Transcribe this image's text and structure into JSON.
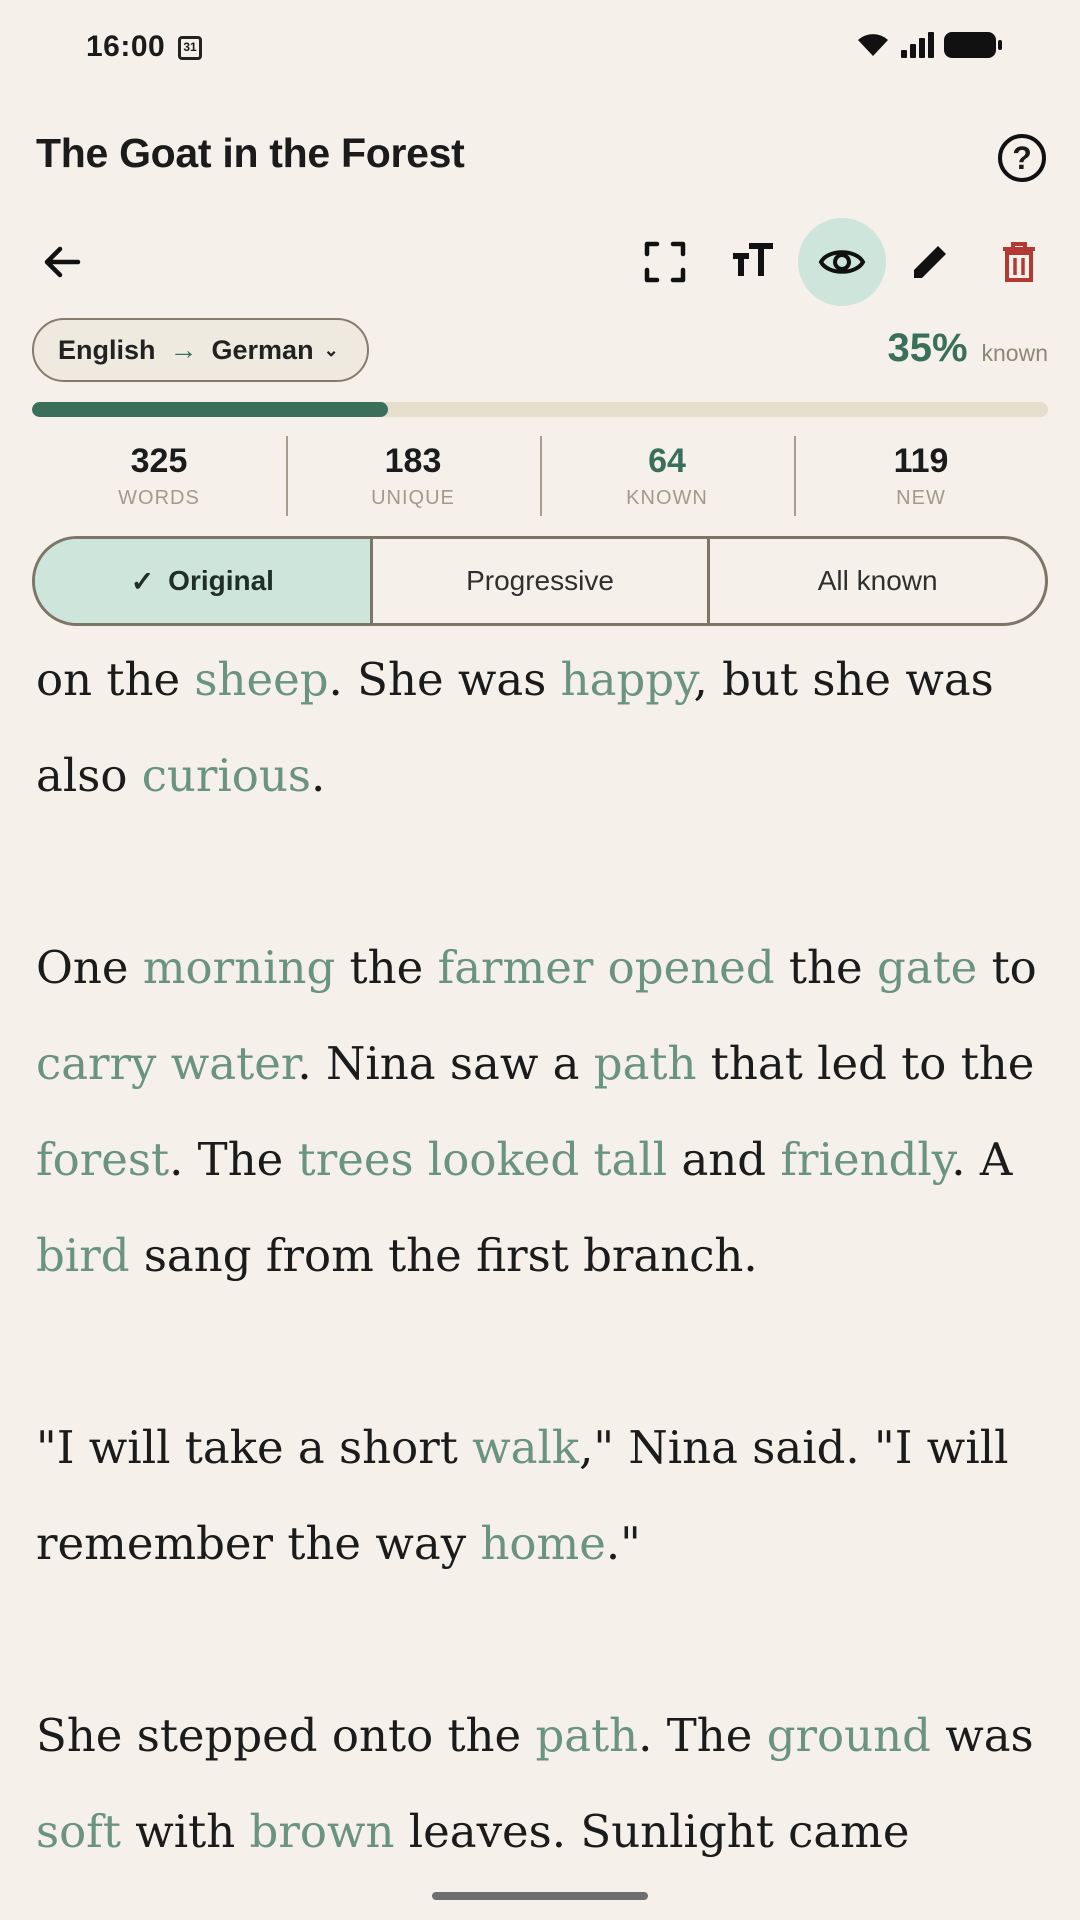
{
  "status": {
    "time": "16:00",
    "calendar_day": "31"
  },
  "header": {
    "title": "The Goat in the Forest",
    "help_icon": "help-icon"
  },
  "toolbar": {
    "icons": [
      "back-arrow-icon",
      "fullscreen-icon",
      "text-size-icon",
      "eye-icon",
      "edit-pencil-icon",
      "delete-trash-icon"
    ],
    "active": "eye-icon",
    "accent": "#CDE5DA",
    "danger": "#B33A34"
  },
  "language": {
    "source": "English",
    "target": "German",
    "arrow": "→"
  },
  "progress": {
    "percent_label": "35%",
    "known_label": "known",
    "fraction": 0.35
  },
  "stats": {
    "words": {
      "value": "325",
      "label": "WORDS"
    },
    "unique": {
      "value": "183",
      "label": "UNIQUE"
    },
    "known": {
      "value": "64",
      "label": "KNOWN"
    },
    "new": {
      "value": "119",
      "label": "NEW"
    }
  },
  "modes": {
    "original": "Original",
    "progressive": "Progressive",
    "all_known": "All known",
    "selected": "Original"
  },
  "colors": {
    "background": "#F5F0E9",
    "known_word": "#6A9380",
    "primary": "#3A6F5B"
  },
  "paragraphs": [
    [
      {
        "t": "on the "
      },
      {
        "t": "sheep",
        "h": true
      },
      {
        "t": ". She was "
      },
      {
        "t": "happy",
        "h": true
      },
      {
        "t": ", but she was also "
      },
      {
        "t": "curious",
        "h": true
      },
      {
        "t": "."
      }
    ],
    [
      {
        "t": "One "
      },
      {
        "t": "morning",
        "h": true
      },
      {
        "t": " the "
      },
      {
        "t": "farmer opened",
        "h": true
      },
      {
        "t": " the "
      },
      {
        "t": "gate",
        "h": true
      },
      {
        "t": " to "
      },
      {
        "t": "carry water",
        "h": true
      },
      {
        "t": ". Nina saw a "
      },
      {
        "t": "path",
        "h": true
      },
      {
        "t": " that led to the "
      },
      {
        "t": "forest",
        "h": true
      },
      {
        "t": ". The "
      },
      {
        "t": "trees looked tall",
        "h": true
      },
      {
        "t": " and "
      },
      {
        "t": "friendly",
        "h": true
      },
      {
        "t": ". A "
      },
      {
        "t": "bird",
        "h": true
      },
      {
        "t": " sang from the first branch."
      }
    ],
    [
      {
        "t": "\"I will take a short "
      },
      {
        "t": "walk",
        "h": true
      },
      {
        "t": ",\" Nina said. \"I will remember the way "
      },
      {
        "t": "home",
        "h": true
      },
      {
        "t": ".\""
      }
    ],
    [
      {
        "t": "She stepped onto the "
      },
      {
        "t": "path",
        "h": true
      },
      {
        "t": ". The "
      },
      {
        "t": "ground",
        "h": true
      },
      {
        "t": " was "
      },
      {
        "t": "soft",
        "h": true
      },
      {
        "t": " with "
      },
      {
        "t": "brown",
        "h": true
      },
      {
        "t": " leaves. Sunlight came"
      }
    ]
  ]
}
